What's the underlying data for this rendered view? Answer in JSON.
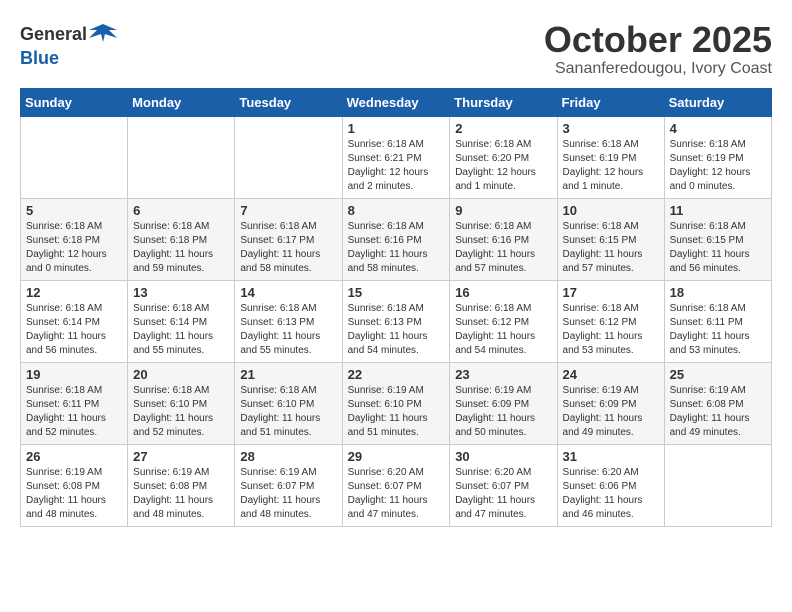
{
  "header": {
    "logo_general": "General",
    "logo_blue": "Blue",
    "month": "October 2025",
    "location": "Sananferedougou, Ivory Coast"
  },
  "days_of_week": [
    "Sunday",
    "Monday",
    "Tuesday",
    "Wednesday",
    "Thursday",
    "Friday",
    "Saturday"
  ],
  "weeks": [
    [
      {
        "day": "",
        "info": ""
      },
      {
        "day": "",
        "info": ""
      },
      {
        "day": "",
        "info": ""
      },
      {
        "day": "1",
        "info": "Sunrise: 6:18 AM\nSunset: 6:21 PM\nDaylight: 12 hours\nand 2 minutes."
      },
      {
        "day": "2",
        "info": "Sunrise: 6:18 AM\nSunset: 6:20 PM\nDaylight: 12 hours\nand 1 minute."
      },
      {
        "day": "3",
        "info": "Sunrise: 6:18 AM\nSunset: 6:19 PM\nDaylight: 12 hours\nand 1 minute."
      },
      {
        "day": "4",
        "info": "Sunrise: 6:18 AM\nSunset: 6:19 PM\nDaylight: 12 hours\nand 0 minutes."
      }
    ],
    [
      {
        "day": "5",
        "info": "Sunrise: 6:18 AM\nSunset: 6:18 PM\nDaylight: 12 hours\nand 0 minutes."
      },
      {
        "day": "6",
        "info": "Sunrise: 6:18 AM\nSunset: 6:18 PM\nDaylight: 11 hours\nand 59 minutes."
      },
      {
        "day": "7",
        "info": "Sunrise: 6:18 AM\nSunset: 6:17 PM\nDaylight: 11 hours\nand 58 minutes."
      },
      {
        "day": "8",
        "info": "Sunrise: 6:18 AM\nSunset: 6:16 PM\nDaylight: 11 hours\nand 58 minutes."
      },
      {
        "day": "9",
        "info": "Sunrise: 6:18 AM\nSunset: 6:16 PM\nDaylight: 11 hours\nand 57 minutes."
      },
      {
        "day": "10",
        "info": "Sunrise: 6:18 AM\nSunset: 6:15 PM\nDaylight: 11 hours\nand 57 minutes."
      },
      {
        "day": "11",
        "info": "Sunrise: 6:18 AM\nSunset: 6:15 PM\nDaylight: 11 hours\nand 56 minutes."
      }
    ],
    [
      {
        "day": "12",
        "info": "Sunrise: 6:18 AM\nSunset: 6:14 PM\nDaylight: 11 hours\nand 56 minutes."
      },
      {
        "day": "13",
        "info": "Sunrise: 6:18 AM\nSunset: 6:14 PM\nDaylight: 11 hours\nand 55 minutes."
      },
      {
        "day": "14",
        "info": "Sunrise: 6:18 AM\nSunset: 6:13 PM\nDaylight: 11 hours\nand 55 minutes."
      },
      {
        "day": "15",
        "info": "Sunrise: 6:18 AM\nSunset: 6:13 PM\nDaylight: 11 hours\nand 54 minutes."
      },
      {
        "day": "16",
        "info": "Sunrise: 6:18 AM\nSunset: 6:12 PM\nDaylight: 11 hours\nand 54 minutes."
      },
      {
        "day": "17",
        "info": "Sunrise: 6:18 AM\nSunset: 6:12 PM\nDaylight: 11 hours\nand 53 minutes."
      },
      {
        "day": "18",
        "info": "Sunrise: 6:18 AM\nSunset: 6:11 PM\nDaylight: 11 hours\nand 53 minutes."
      }
    ],
    [
      {
        "day": "19",
        "info": "Sunrise: 6:18 AM\nSunset: 6:11 PM\nDaylight: 11 hours\nand 52 minutes."
      },
      {
        "day": "20",
        "info": "Sunrise: 6:18 AM\nSunset: 6:10 PM\nDaylight: 11 hours\nand 52 minutes."
      },
      {
        "day": "21",
        "info": "Sunrise: 6:18 AM\nSunset: 6:10 PM\nDaylight: 11 hours\nand 51 minutes."
      },
      {
        "day": "22",
        "info": "Sunrise: 6:19 AM\nSunset: 6:10 PM\nDaylight: 11 hours\nand 51 minutes."
      },
      {
        "day": "23",
        "info": "Sunrise: 6:19 AM\nSunset: 6:09 PM\nDaylight: 11 hours\nand 50 minutes."
      },
      {
        "day": "24",
        "info": "Sunrise: 6:19 AM\nSunset: 6:09 PM\nDaylight: 11 hours\nand 49 minutes."
      },
      {
        "day": "25",
        "info": "Sunrise: 6:19 AM\nSunset: 6:08 PM\nDaylight: 11 hours\nand 49 minutes."
      }
    ],
    [
      {
        "day": "26",
        "info": "Sunrise: 6:19 AM\nSunset: 6:08 PM\nDaylight: 11 hours\nand 48 minutes."
      },
      {
        "day": "27",
        "info": "Sunrise: 6:19 AM\nSunset: 6:08 PM\nDaylight: 11 hours\nand 48 minutes."
      },
      {
        "day": "28",
        "info": "Sunrise: 6:19 AM\nSunset: 6:07 PM\nDaylight: 11 hours\nand 48 minutes."
      },
      {
        "day": "29",
        "info": "Sunrise: 6:20 AM\nSunset: 6:07 PM\nDaylight: 11 hours\nand 47 minutes."
      },
      {
        "day": "30",
        "info": "Sunrise: 6:20 AM\nSunset: 6:07 PM\nDaylight: 11 hours\nand 47 minutes."
      },
      {
        "day": "31",
        "info": "Sunrise: 6:20 AM\nSunset: 6:06 PM\nDaylight: 11 hours\nand 46 minutes."
      },
      {
        "day": "",
        "info": ""
      }
    ]
  ]
}
